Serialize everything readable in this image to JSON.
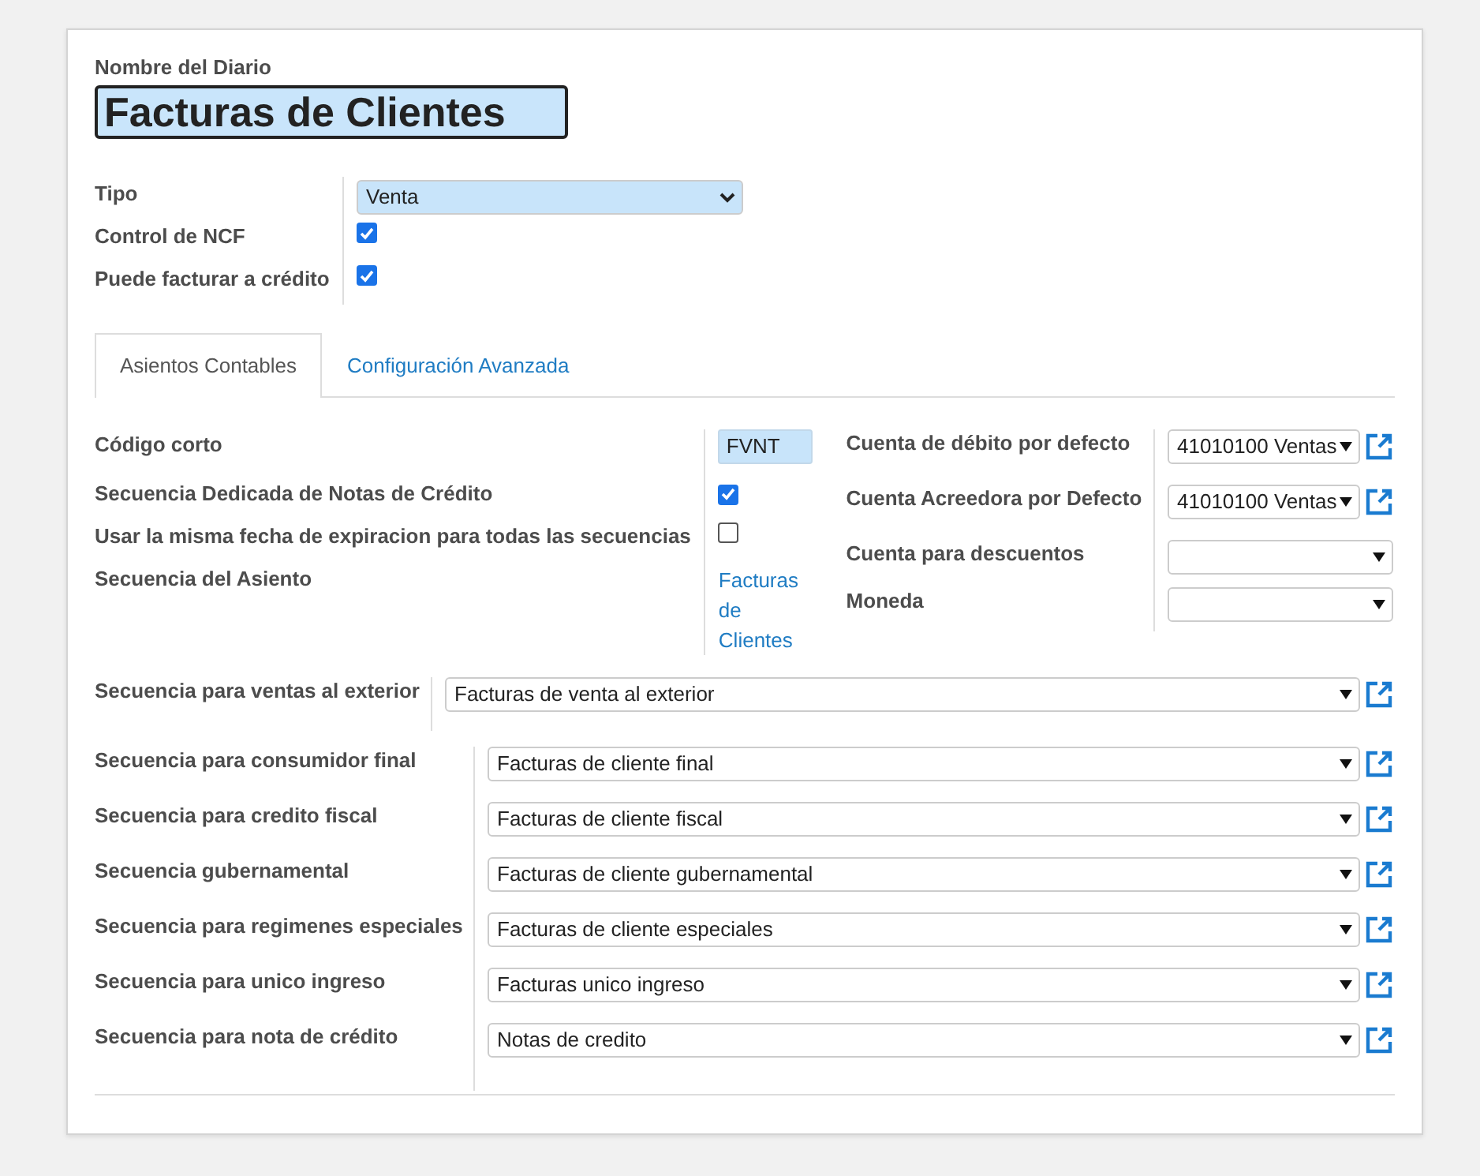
{
  "journal_name": {
    "label": "Nombre del Diario",
    "value": "Facturas de Clientes"
  },
  "general_fields": [
    {
      "kind": "select",
      "label": "Tipo",
      "value": "Venta"
    },
    {
      "kind": "checkbox",
      "label": "Control de NCF",
      "checked": true
    },
    {
      "kind": "checkbox",
      "label": "Puede facturar a crédito",
      "checked": true
    }
  ],
  "tabs": [
    {
      "label": "Asientos Contables",
      "selected": true
    },
    {
      "label": "Configuración Avanzada",
      "selected": false
    }
  ],
  "left_fields": [
    {
      "kind": "text",
      "label": "Código corto",
      "value": "FVNT"
    },
    {
      "kind": "checkbox",
      "label": "Secuencia Dedicada de Notas de Crédito",
      "checked": true
    },
    {
      "kind": "checkbox",
      "label": "Usar la misma fecha de expiracion para todas las secuencias",
      "checked": false
    },
    {
      "kind": "link",
      "label": "Secuencia del Asiento",
      "value": "Facturas de Clientes"
    }
  ],
  "right_fields": [
    {
      "label": "Cuenta de débito por defecto",
      "value": "41010100 Ventas"
    },
    {
      "label": "Cuenta Acreedora por Defecto",
      "value": "41010100 Ventas"
    },
    {
      "label": "Cuenta para descuentos"
    },
    {
      "label": "Moneda"
    }
  ],
  "exterior_sequence": {
    "label": "Secuencia para ventas al exterior",
    "value": "Facturas de venta al exterior"
  },
  "sequences": [
    {
      "label": "Secuencia para consumidor final",
      "value": "Facturas de cliente final"
    },
    {
      "label": "Secuencia para credito fiscal",
      "value": "Facturas de cliente fiscal"
    },
    {
      "label": "Secuencia gubernamental",
      "value": "Facturas de cliente gubernamental"
    },
    {
      "label": "Secuencia para regimenes especiales",
      "value": "Facturas de cliente especiales"
    },
    {
      "label": "Secuencia para unico ingreso",
      "value": "Facturas unico ingreso"
    },
    {
      "label": "Secuencia para nota de crédito",
      "value": "Notas de credito"
    }
  ]
}
